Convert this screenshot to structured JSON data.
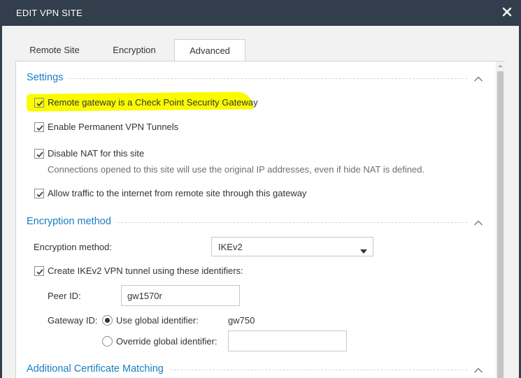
{
  "dialog": {
    "title": "EDIT VPN SITE",
    "close_icon": "close-icon"
  },
  "tabs": [
    {
      "label": "Remote Site",
      "active": false
    },
    {
      "label": "Encryption",
      "active": false
    },
    {
      "label": "Advanced",
      "active": true
    }
  ],
  "settings": {
    "title": "Settings",
    "remote_gateway": {
      "label": "Remote gateway is a Check Point Security Gateway",
      "checked": true,
      "highlighted": true,
      "highlight_color": "#fbfb00"
    },
    "permanent_tunnels": {
      "label": "Enable Permanent VPN Tunnels",
      "checked": true
    },
    "disable_nat": {
      "label": "Disable NAT for this site",
      "checked": true,
      "description": "Connections opened to this site will use the original IP addresses, even if hide NAT is defined."
    },
    "allow_internet": {
      "label": "Allow traffic to the internet from remote site through this gateway",
      "checked": true
    }
  },
  "encryption_method": {
    "title": "Encryption method",
    "method_label": "Encryption method:",
    "method_value": "IKEv2",
    "ikev2_tunnel": {
      "label": "Create IKEv2 VPN tunnel using these identifiers:",
      "checked": true
    },
    "peer_id_label": "Peer ID:",
    "peer_id_value": "gw1570r",
    "gateway_id_label": "Gateway ID:",
    "use_global": {
      "label": "Use global identifier:",
      "selected": true,
      "value": "gw750"
    },
    "override_global": {
      "label": "Override global identifier:",
      "selected": false,
      "value": ""
    }
  },
  "additional": {
    "title": "Additional Certificate Matching"
  },
  "colors": {
    "titlebar": "#333e4c",
    "accent": "#1b7cc1",
    "highlight": "#fbfb00"
  }
}
